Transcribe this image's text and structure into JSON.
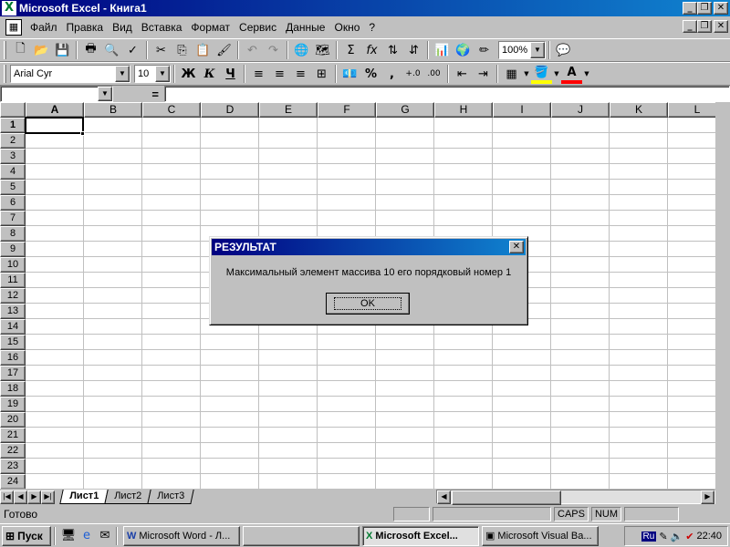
{
  "app": {
    "title": "Microsoft Excel - Книга1"
  },
  "menu": {
    "items": [
      {
        "label": "Файл"
      },
      {
        "label": "Правка"
      },
      {
        "label": "Вид"
      },
      {
        "label": "Вставка"
      },
      {
        "label": "Формат"
      },
      {
        "label": "Сервис"
      },
      {
        "label": "Данные"
      },
      {
        "label": "Окно"
      },
      {
        "label": "?"
      }
    ]
  },
  "toolbar": {
    "zoom": "100%"
  },
  "format_toolbar": {
    "font": "Arial Cyr",
    "size": "10",
    "bold": "Ж",
    "italic": "К",
    "underline": "Ч"
  },
  "formula": {
    "name_box": "",
    "equals": "="
  },
  "grid": {
    "columns": [
      "A",
      "B",
      "C",
      "D",
      "E",
      "F",
      "G",
      "H",
      "I",
      "J",
      "K",
      "L"
    ],
    "rows": [
      "1",
      "2",
      "3",
      "4",
      "5",
      "6",
      "7",
      "8",
      "9",
      "10",
      "11",
      "12",
      "13",
      "14",
      "15",
      "16",
      "17",
      "18",
      "19",
      "20",
      "21",
      "22",
      "23",
      "24"
    ],
    "active_cell": "A1"
  },
  "sheets": [
    {
      "label": "Лист1",
      "active": true
    },
    {
      "label": "Лист2",
      "active": false
    },
    {
      "label": "Лист3",
      "active": false
    }
  ],
  "status": {
    "text": "Готово",
    "caps": "CAPS",
    "num": "NUM"
  },
  "dialog": {
    "title": "РЕЗУЛЬТАТ",
    "message": "Максимальный элемент массива  10 его порядковый номер  1",
    "ok": "OK"
  },
  "taskbar": {
    "start": "Пуск",
    "tasks": [
      {
        "label": "Microsoft Word - Л...",
        "active": false
      },
      {
        "label": "",
        "active": false
      },
      {
        "label": "Microsoft Excel...",
        "active": true
      },
      {
        "label": "Microsoft Visual Ba...",
        "active": false
      }
    ],
    "lang": "Ru",
    "clock": "22:40"
  },
  "colors": {
    "title_bar": "#000080",
    "title_gradient_end": "#1084d0",
    "face": "#c0c0c0"
  }
}
